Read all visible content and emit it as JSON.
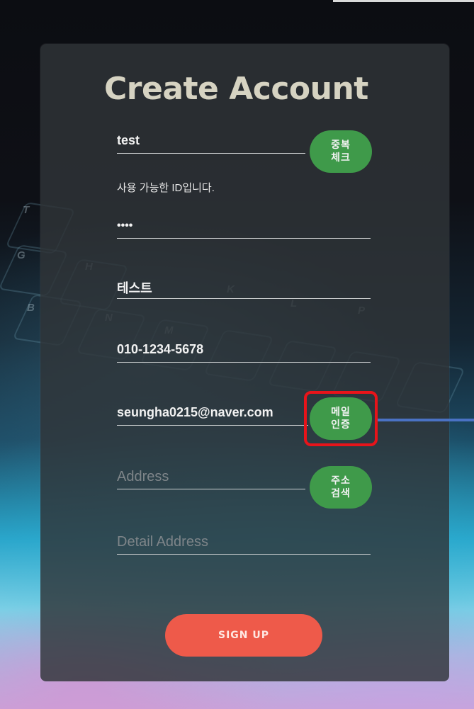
{
  "form": {
    "title": "Create Account",
    "id": {
      "value": "test",
      "check_button": "중복 체크"
    },
    "id_hint": "사용 가능한 ID입니다.",
    "password": {
      "value": "••••"
    },
    "name": {
      "value": "테스트"
    },
    "phone": {
      "value": "010-1234-5678"
    },
    "email": {
      "value": "seungha0215@naver.com",
      "verify_button": "메일 인증"
    },
    "address": {
      "placeholder": "Address",
      "search_button": "주소 검색"
    },
    "detail_address": {
      "placeholder": "Detail Address"
    },
    "submit_label": "SIGN UP"
  },
  "colors": {
    "card_bg": "#30353a",
    "green_button": "#3f9a4a",
    "signup_button": "#ee5a4a",
    "highlight_box": "#e8141a",
    "arrow": "#4a72c4",
    "title": "#d6d3c2"
  },
  "keyboard_key_labels": [
    "T",
    "G",
    "H",
    "B",
    "N",
    "M",
    "K",
    "L",
    "P"
  ]
}
